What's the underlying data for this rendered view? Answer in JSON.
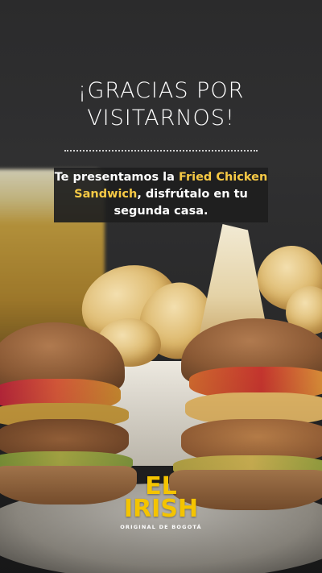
{
  "headline": {
    "line1": "¡GRACIAS POR",
    "line2": "VISITARNOS!"
  },
  "message": {
    "part1": "Te presentamos la ",
    "highlight": "Fried Chicken Sandwich",
    "part2": ", disfrútalo en tu segunda casa."
  },
  "logo": {
    "line1": "EL",
    "line2": "IRISH",
    "tagline": "ORIGINAL DE BOGOTÁ"
  },
  "colors": {
    "highlight": "#f6c945",
    "logo": "#f4c400",
    "text": "#ffffff",
    "background": "#2b2b2c"
  }
}
